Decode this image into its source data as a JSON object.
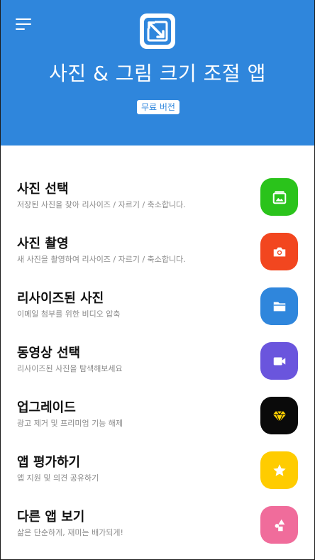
{
  "header": {
    "title": "사진 & 그림 크기 조절 앱",
    "badge": "무료 버전",
    "bg_color": "#2f86dc",
    "menu_icon": "hamburger-menu-icon",
    "logo_icon": "resize-arrow-logo-icon"
  },
  "items": [
    {
      "title": "사진 선택",
      "subtitle": "저장된 사진을 찾아 리사이즈 / 자르기 / 축소합니다.",
      "color": "#2ac31b",
      "icon": "image-frame-icon"
    },
    {
      "title": "사진 촬영",
      "subtitle": "새 사진을 촬영하여 리사이즈 / 자르기 / 축소합니다.",
      "color": "#f2461f",
      "icon": "camera-icon"
    },
    {
      "title": "리사이즈된 사진",
      "subtitle": "이메일 첨부를 위한 비디오 압축",
      "color": "#2f86dc",
      "icon": "folder-icon"
    },
    {
      "title": "동영상 선택",
      "subtitle": "리사이즈된 사진을 탐색해보세요",
      "color": "#6a55dd",
      "icon": "video-camera-icon"
    },
    {
      "title": "업그레이드",
      "subtitle": "광고 제거 및 프리미엄 기능 해제",
      "color": "#0a0a0a",
      "icon": "diamond-icon"
    },
    {
      "title": "앱 평가하기",
      "subtitle": "앱 지원 및 의견 공유하기",
      "color": "#ffcc00",
      "icon": "star-icon"
    },
    {
      "title": "다른 앱 보기",
      "subtitle": "삶은 단순하게, 재미는 배가되게!",
      "color": "#f06c9b",
      "icon": "shapes-icon"
    }
  ]
}
